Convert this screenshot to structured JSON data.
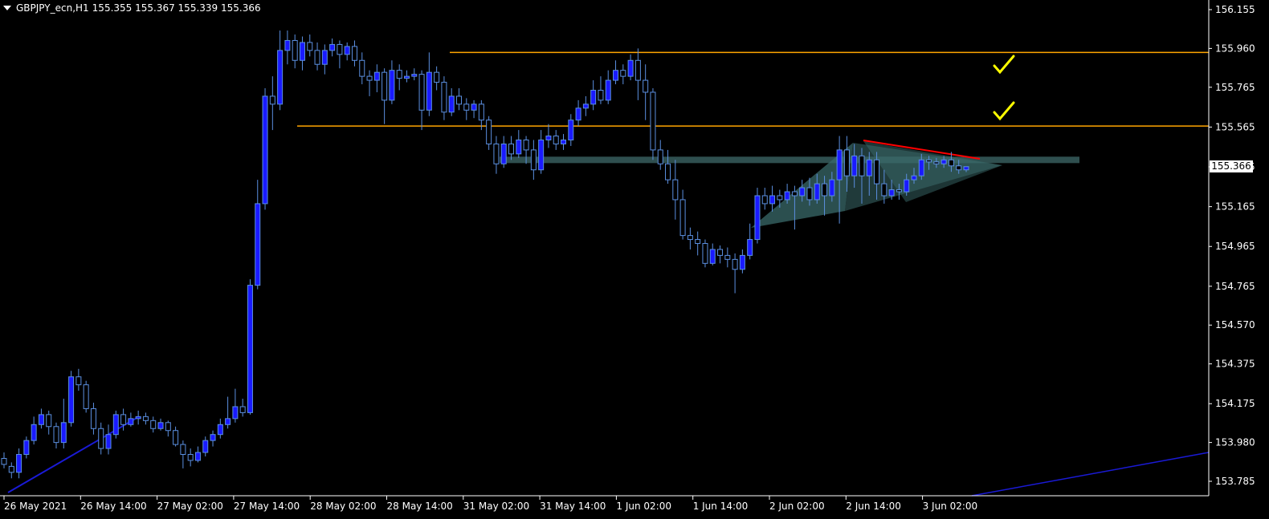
{
  "header": {
    "symbol": "GBPJPY_ecn,H1",
    "ohlc": "155.355 155.367 155.339 155.366"
  },
  "current_price": "155.366",
  "colors": {
    "background": "#000000",
    "candle": "#5b8fe0",
    "bull_body": "#1a1aff",
    "hline": "#ffa500",
    "zone": "#2f4f4f",
    "triangle": "#3a6a6a",
    "trend_red": "#ff0000",
    "trend_blue": "#1a1ad6",
    "check": "#ffff00",
    "axis": "#ffffff"
  },
  "chart_data": {
    "type": "candlestick",
    "y_ticks": [
      "156.155",
      "155.960",
      "155.765",
      "155.565",
      "155.365",
      "155.165",
      "154.965",
      "154.765",
      "154.570",
      "154.375",
      "154.175",
      "153.980",
      "153.785"
    ],
    "x_ticks": [
      "26 May 2021",
      "26 May 14:00",
      "27 May 02:00",
      "27 May 14:00",
      "28 May 02:00",
      "28 May 14:00",
      "31 May 02:00",
      "31 May 14:00",
      "1 Jun 02:00",
      "1 Jun 14:00",
      "2 Jun 02:00",
      "2 Jun 14:00",
      "3 Jun 02:00"
    ],
    "ylim": [
      153.74,
      156.18
    ],
    "horizontal_levels": [
      155.94,
      155.57
    ],
    "zone_level": 155.4,
    "candles": [
      [
        153.9,
        153.87,
        153.93,
        153.85
      ],
      [
        153.86,
        153.83,
        153.88,
        153.8
      ],
      [
        153.83,
        153.92,
        153.95,
        153.8
      ],
      [
        153.92,
        153.99,
        154.01,
        153.9
      ],
      [
        153.99,
        154.07,
        154.11,
        153.97
      ],
      [
        154.07,
        154.12,
        154.15,
        154.05
      ],
      [
        154.12,
        154.06,
        154.14,
        154.02
      ],
      [
        154.06,
        153.98,
        154.08,
        153.95
      ],
      [
        153.98,
        154.08,
        154.2,
        153.95
      ],
      [
        154.08,
        154.31,
        154.34,
        154.06
      ],
      [
        154.31,
        154.27,
        154.35,
        154.24
      ],
      [
        154.27,
        154.15,
        154.29,
        154.13
      ],
      [
        154.15,
        154.05,
        154.18,
        154.02
      ],
      [
        154.05,
        153.95,
        154.08,
        153.92
      ],
      [
        153.95,
        154.02,
        154.07,
        153.92
      ],
      [
        154.02,
        154.12,
        154.14,
        154.0
      ],
      [
        154.12,
        154.07,
        154.15,
        154.04
      ],
      [
        154.07,
        154.1,
        154.13,
        154.06
      ],
      [
        154.1,
        154.11,
        154.14,
        154.07
      ],
      [
        154.11,
        154.09,
        154.13,
        154.07
      ],
      [
        154.09,
        154.05,
        154.11,
        154.03
      ],
      [
        154.05,
        154.08,
        154.1,
        154.04
      ],
      [
        154.08,
        154.04,
        154.09,
        154.01
      ],
      [
        154.04,
        153.97,
        154.06,
        153.96
      ],
      [
        153.97,
        153.92,
        153.99,
        153.85
      ],
      [
        153.92,
        153.89,
        153.95,
        153.86
      ],
      [
        153.89,
        153.93,
        153.96,
        153.88
      ],
      [
        153.93,
        153.99,
        154.01,
        153.91
      ],
      [
        153.99,
        154.02,
        154.04,
        153.96
      ],
      [
        154.02,
        154.07,
        154.1,
        154.0
      ],
      [
        154.07,
        154.1,
        154.21,
        154.05
      ],
      [
        154.1,
        154.16,
        154.25,
        154.08
      ],
      [
        154.16,
        154.13,
        154.2,
        154.11
      ],
      [
        154.13,
        154.77,
        154.8,
        154.12
      ],
      [
        154.77,
        155.18,
        155.3,
        154.75
      ],
      [
        155.18,
        155.72,
        155.76,
        155.15
      ],
      [
        155.72,
        155.68,
        155.82,
        155.55
      ],
      [
        155.68,
        155.95,
        156.05,
        155.65
      ],
      [
        155.95,
        156.0,
        156.05,
        155.88
      ],
      [
        156.0,
        155.9,
        156.03,
        155.86
      ],
      [
        155.9,
        155.99,
        156.02,
        155.85
      ],
      [
        155.99,
        155.95,
        156.03,
        155.92
      ],
      [
        155.95,
        155.88,
        155.99,
        155.85
      ],
      [
        155.88,
        155.95,
        155.98,
        155.83
      ],
      [
        155.95,
        155.98,
        156.01,
        155.92
      ],
      [
        155.98,
        155.93,
        156.0,
        155.86
      ],
      [
        155.93,
        155.97,
        155.99,
        155.9
      ],
      [
        155.97,
        155.9,
        156.0,
        155.87
      ],
      [
        155.9,
        155.82,
        155.94,
        155.78
      ],
      [
        155.82,
        155.8,
        155.85,
        155.72
      ],
      [
        155.8,
        155.84,
        155.88,
        155.74
      ],
      [
        155.84,
        155.7,
        155.86,
        155.58
      ],
      [
        155.7,
        155.85,
        155.9,
        155.68
      ],
      [
        155.85,
        155.81,
        155.88,
        155.75
      ],
      [
        155.81,
        155.82,
        155.85,
        155.79
      ],
      [
        155.82,
        155.83,
        155.86,
        155.8
      ],
      [
        155.83,
        155.65,
        155.85,
        155.55
      ],
      [
        155.65,
        155.84,
        155.94,
        155.62
      ],
      [
        155.84,
        155.79,
        155.87,
        155.75
      ],
      [
        155.79,
        155.64,
        155.82,
        155.6
      ],
      [
        155.64,
        155.72,
        155.76,
        155.62
      ],
      [
        155.72,
        155.68,
        155.76,
        155.65
      ],
      [
        155.68,
        155.65,
        155.71,
        155.6
      ],
      [
        155.65,
        155.68,
        155.7,
        155.61
      ],
      [
        155.68,
        155.6,
        155.7,
        155.55
      ],
      [
        155.6,
        155.48,
        155.62,
        155.45
      ],
      [
        155.48,
        155.38,
        155.52,
        155.33
      ],
      [
        155.38,
        155.48,
        155.52,
        155.36
      ],
      [
        155.48,
        155.43,
        155.52,
        155.4
      ],
      [
        155.43,
        155.5,
        155.55,
        155.41
      ],
      [
        155.5,
        155.45,
        155.52,
        155.38
      ],
      [
        155.45,
        155.35,
        155.5,
        155.3
      ],
      [
        155.35,
        155.5,
        155.55,
        155.33
      ],
      [
        155.5,
        155.52,
        155.58,
        155.46
      ],
      [
        155.52,
        155.48,
        155.55,
        155.45
      ],
      [
        155.48,
        155.5,
        155.53,
        155.45
      ],
      [
        155.5,
        155.6,
        155.63,
        155.47
      ],
      [
        155.6,
        155.66,
        155.7,
        155.57
      ],
      [
        155.66,
        155.68,
        155.72,
        155.62
      ],
      [
        155.68,
        155.75,
        155.8,
        155.65
      ],
      [
        155.75,
        155.7,
        155.82,
        155.68
      ],
      [
        155.7,
        155.8,
        155.85,
        155.68
      ],
      [
        155.8,
        155.85,
        155.9,
        155.78
      ],
      [
        155.85,
        155.82,
        155.88,
        155.78
      ],
      [
        155.82,
        155.9,
        155.93,
        155.8
      ],
      [
        155.9,
        155.8,
        155.96,
        155.7
      ],
      [
        155.8,
        155.74,
        155.88,
        155.6
      ],
      [
        155.74,
        155.45,
        155.76,
        155.4
      ],
      [
        155.45,
        155.38,
        155.5,
        155.35
      ],
      [
        155.38,
        155.3,
        155.45,
        155.28
      ],
      [
        155.3,
        155.2,
        155.4,
        155.1
      ],
      [
        155.2,
        155.02,
        155.25,
        155.0
      ],
      [
        155.02,
        155.0,
        155.06,
        154.95
      ],
      [
        155.0,
        154.98,
        155.04,
        154.92
      ],
      [
        154.98,
        154.88,
        155.0,
        154.86
      ],
      [
        154.88,
        154.95,
        154.98,
        154.87
      ],
      [
        154.95,
        154.92,
        154.97,
        154.88
      ],
      [
        154.92,
        154.9,
        154.96,
        154.86
      ],
      [
        154.9,
        154.85,
        154.93,
        154.73
      ],
      [
        154.85,
        154.92,
        154.95,
        154.83
      ],
      [
        154.92,
        155.0,
        155.08,
        154.9
      ],
      [
        155.0,
        155.22,
        155.26,
        154.98
      ],
      [
        155.22,
        155.18,
        155.26,
        155.15
      ],
      [
        155.18,
        155.22,
        155.27,
        155.14
      ],
      [
        155.22,
        155.2,
        155.25,
        155.16
      ],
      [
        155.2,
        155.24,
        155.28,
        155.18
      ],
      [
        155.24,
        155.22,
        155.27,
        155.05
      ],
      [
        155.22,
        155.26,
        155.3,
        155.19
      ],
      [
        155.26,
        155.2,
        155.31,
        155.17
      ],
      [
        155.2,
        155.28,
        155.33,
        155.18
      ],
      [
        155.28,
        155.22,
        155.32,
        155.12
      ],
      [
        155.22,
        155.3,
        155.34,
        155.19
      ],
      [
        155.3,
        155.45,
        155.52,
        155.08
      ],
      [
        155.45,
        155.32,
        155.52,
        155.24
      ],
      [
        155.32,
        155.42,
        155.48,
        155.26
      ],
      [
        155.42,
        155.32,
        155.46,
        155.18
      ],
      [
        155.32,
        155.4,
        155.44,
        155.22
      ],
      [
        155.4,
        155.28,
        155.44,
        155.2
      ],
      [
        155.28,
        155.22,
        155.35,
        155.18
      ],
      [
        155.22,
        155.25,
        155.3,
        155.2
      ],
      [
        155.25,
        155.24,
        155.28,
        155.2
      ],
      [
        155.24,
        155.3,
        155.33,
        155.22
      ],
      [
        155.3,
        155.32,
        155.36,
        155.28
      ],
      [
        155.32,
        155.4,
        155.43,
        155.3
      ],
      [
        155.4,
        155.39,
        155.42,
        155.35
      ],
      [
        155.39,
        155.38,
        155.41,
        155.36
      ],
      [
        155.38,
        155.4,
        155.42,
        155.36
      ],
      [
        155.4,
        155.37,
        155.44,
        155.34
      ],
      [
        155.37,
        155.35,
        155.4,
        155.33
      ],
      [
        155.35,
        155.366,
        155.367,
        155.339
      ]
    ]
  }
}
